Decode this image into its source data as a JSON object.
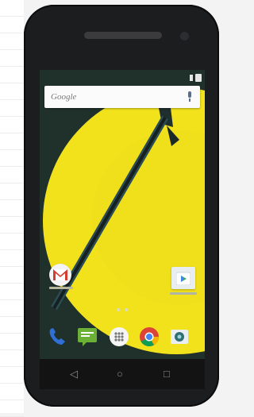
{
  "search": {
    "brand": "Google",
    "mic_icon": "mic-icon"
  },
  "status_bar": {
    "icons": [
      "signal-icon",
      "battery-icon"
    ]
  },
  "home_apps": [
    {
      "name": "gmail",
      "icon": "gmail-icon"
    },
    {
      "name": "play-store",
      "icon": "play-store-icon"
    }
  ],
  "page_indicator": {
    "pages": 2
  },
  "dock": [
    "phone-icon",
    "messaging-icon",
    "app-drawer-icon",
    "chrome-icon",
    "camera-icon"
  ],
  "nav_bar": {
    "back": "◁",
    "home": "○",
    "recents": "□"
  },
  "colors": {
    "phone_body": "#1c1d1f",
    "wallpaper_yellow": "#f2e21c",
    "wallpaper_dark": "#20302a"
  }
}
